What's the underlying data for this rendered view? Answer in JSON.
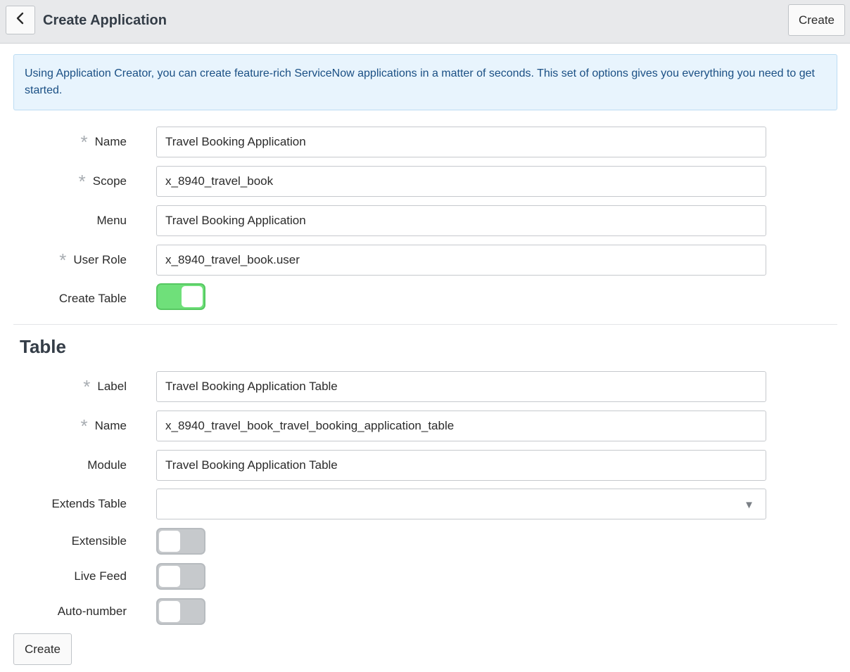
{
  "header": {
    "title": "Create Application",
    "create_label": "Create"
  },
  "info": {
    "text": "Using Application Creator, you can create feature-rich ServiceNow applications in a matter of seconds. This set of options gives you everything you need to get started."
  },
  "app": {
    "name": {
      "label": "Name",
      "value": "Travel Booking Application",
      "required": true
    },
    "scope": {
      "label": "Scope",
      "value": "x_8940_travel_book",
      "required": true
    },
    "menu": {
      "label": "Menu",
      "value": "Travel Booking Application",
      "required": false
    },
    "user_role": {
      "label": "User Role",
      "value": "x_8940_travel_book.user",
      "required": true
    },
    "create_table": {
      "label": "Create Table",
      "checked": true
    }
  },
  "table": {
    "title": "Table",
    "label": {
      "label": "Label",
      "value": "Travel Booking Application Table",
      "required": true
    },
    "name": {
      "label": "Name",
      "value": "x_8940_travel_book_travel_booking_application_table",
      "required": true
    },
    "module": {
      "label": "Module",
      "value": "Travel Booking Application Table",
      "required": false
    },
    "extends_table": {
      "label": "Extends Table",
      "value": ""
    },
    "extensible": {
      "label": "Extensible",
      "checked": false
    },
    "live_feed": {
      "label": "Live Feed",
      "checked": false
    },
    "auto_number": {
      "label": "Auto-number",
      "checked": false
    }
  },
  "footer": {
    "create_label": "Create"
  },
  "icons": {
    "back": "chevron-left-icon",
    "required": "asterisk-icon",
    "dropdown": "triangle-down-icon"
  },
  "colors": {
    "toggle_on": "#6fe07a",
    "info_bg": "#e8f4fd",
    "info_text": "#1a4f84"
  }
}
